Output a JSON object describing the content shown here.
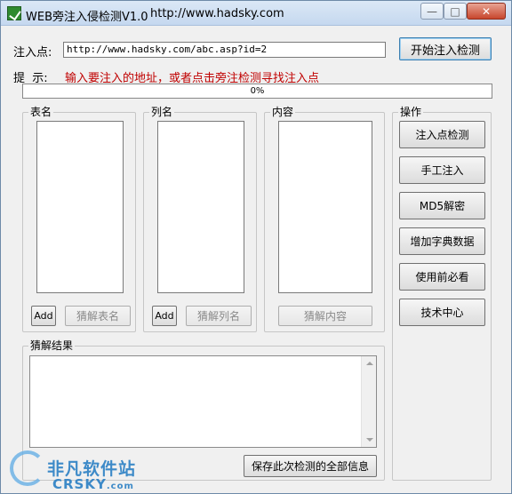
{
  "window": {
    "title": "WEB旁注入侵检测V1.0",
    "url": "http://www.hadsky.com"
  },
  "controls": {
    "minimize": "—",
    "maximize": "□",
    "close": "✕"
  },
  "inject": {
    "label": "注入点:",
    "value": "http://www.hadsky.com/abc.asp?id=2",
    "start_button": "开始注入检测"
  },
  "hint": {
    "label": "提  示:",
    "text": "输入要注入的地址，或者点击旁注检测寻找注入点"
  },
  "progress": {
    "value": 0,
    "text": "0%"
  },
  "tables": {
    "title": "表名",
    "add": "Add",
    "guess": "猜解表名"
  },
  "columns": {
    "title": "列名",
    "add": "Add",
    "guess": "猜解列名"
  },
  "content": {
    "title": "内容",
    "guess": "猜解内容"
  },
  "result": {
    "title": "猜解结果",
    "save": "保存此次检测的全部信息"
  },
  "operations": {
    "title": "操作",
    "buttons": [
      "注入点检测",
      "手工注入",
      "MD5解密",
      "增加字典数据",
      "使用前必看",
      "技术中心"
    ]
  },
  "watermark": {
    "cn": "非凡软件站",
    "en": "CRSKY",
    "suffix": ".com"
  }
}
